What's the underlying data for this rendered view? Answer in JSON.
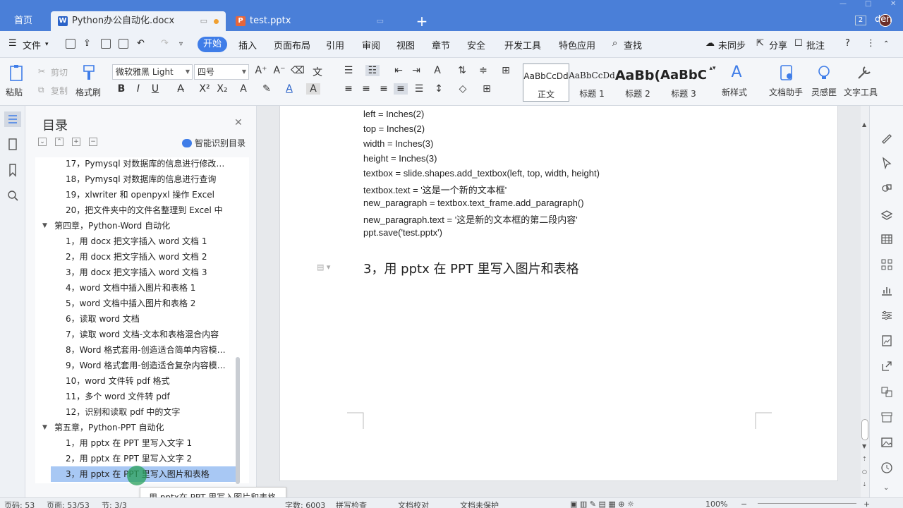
{
  "titlebar": {
    "home_tab": "首页",
    "doc_tab": "Python办公自动化.docx",
    "ppt_tab": "test.pptx",
    "add_tab": "+",
    "badge": "2",
    "user": "den",
    "doc_icon": "W",
    "ppt_icon": "P"
  },
  "menu": {
    "file": "文件",
    "items": [
      "开始",
      "插入",
      "页面布局",
      "引用",
      "审阅",
      "视图",
      "章节",
      "安全",
      "开发工具",
      "特色应用",
      "查找"
    ],
    "right": [
      "未同步",
      "分享",
      "批注"
    ],
    "help": "?"
  },
  "ribbon": {
    "paste": "粘贴",
    "cut": "剪切",
    "copy": "复制",
    "format_painter": "格式刷",
    "font_name": "微软雅黑 Light",
    "font_size": "四号",
    "styles": [
      {
        "preview": "AaBbCcDd",
        "name": "正文"
      },
      {
        "preview": "AaBbCcDd",
        "name": "标题 1"
      },
      {
        "preview": "AaBb(",
        "name": "标题 2"
      },
      {
        "preview": "AaBbC",
        "name": "标题 3"
      }
    ],
    "new_style": "新样式",
    "doc_assistant": "文档助手",
    "inspiration": "灵感匣",
    "text_tools": "文字工具"
  },
  "nav": {
    "title": "目录",
    "smart_detect": "智能识别目录",
    "items": [
      {
        "level": 2,
        "text": "17，Pymysql 对数据库的信息进行修改…"
      },
      {
        "level": 2,
        "text": "18，Pymysql 对数据库的信息进行查询"
      },
      {
        "level": 2,
        "text": "19，xlwriter 和 openpyxl 操作 Excel"
      },
      {
        "level": 2,
        "text": "20，把文件夹中的文件名整理到 Excel 中"
      },
      {
        "level": 1,
        "text": "第四章，Python-Word 自动化"
      },
      {
        "level": 2,
        "text": "1，用 docx 把文字插入 word 文档 1"
      },
      {
        "level": 2,
        "text": "2，用 docx 把文字插入 word 文档 2"
      },
      {
        "level": 2,
        "text": "3，用 docx 把文字插入 word 文档 3"
      },
      {
        "level": 2,
        "text": "4，word 文档中插入图片和表格 1"
      },
      {
        "level": 2,
        "text": "5，word 文档中插入图片和表格 2"
      },
      {
        "level": 2,
        "text": "6，读取 word 文档"
      },
      {
        "level": 2,
        "text": "7，读取 word 文档-文本和表格混合内容"
      },
      {
        "level": 2,
        "text": "8，Word 格式套用-创造适合简单内容模…"
      },
      {
        "level": 2,
        "text": "9，Word 格式套用-创造适合复杂内容模…"
      },
      {
        "level": 2,
        "text": "10，word 文件转 pdf 格式"
      },
      {
        "level": 2,
        "text": "11，多个 word 文件转 pdf"
      },
      {
        "level": 2,
        "text": "12，识别和读取 pdf 中的文字"
      },
      {
        "level": 1,
        "text": "第五章，Python-PPT 自动化"
      },
      {
        "level": 2,
        "text": "1，用 pptx 在 PPT 里写入文字 1"
      },
      {
        "level": 2,
        "text": "2，用 pptx 在 PPT 里写入文字 2"
      },
      {
        "level": 2,
        "text": "3，用 pptx 在 PPT 里写入图片和表格",
        "selected": true
      }
    ],
    "tooltip": "用 pptx在 PPT 里写入图片和表格"
  },
  "doc": {
    "code_lines": [
      "left = Inches(2)",
      "top = Inches(2)",
      "width = Inches(3)",
      "height = Inches(3)",
      "textbox = slide.shapes.add_textbox(left, top, width, height)",
      "textbox.text = '这是一个新的文本框'",
      "new_paragraph = textbox.text_frame.add_paragraph()",
      "new_paragraph.text = '这是新的文本框的第二段内容'",
      "ppt.save('test.pptx')"
    ],
    "heading": "3，用 pptx 在 PPT 里写入图片和表格"
  },
  "status": {
    "page_num": "页码: 53",
    "pages": "页面: 53/53",
    "section": "节: 3/3",
    "word_count": "字数: 6003",
    "spell_check": "拼写检查",
    "proofread": "文档校对",
    "protect": "文档未保护",
    "zoom": "100%"
  },
  "colors": {
    "titlebar": "#4a7fd8",
    "accent": "#3f7de8",
    "selection": "#a8c8f4"
  }
}
